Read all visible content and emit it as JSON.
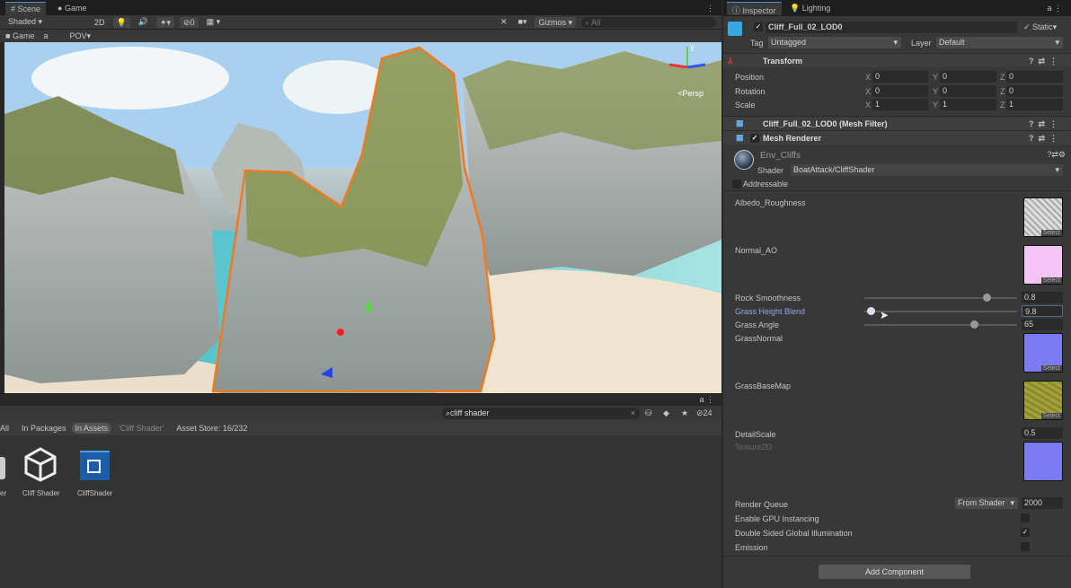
{
  "scene_tabs": [
    {
      "label": "Scene",
      "icon": "hash-icon"
    },
    {
      "label": "Game",
      "icon": "gamepad-icon"
    }
  ],
  "toolbar": {
    "shading": "Shaded",
    "mode_2d": "2D",
    "hidden_count": "0",
    "gizmos": "Gizmos",
    "search_placeholder": "All"
  },
  "gamebar": {
    "game": "Game",
    "pov": "POV"
  },
  "gizmo": {
    "y_label": "y",
    "persp": "<Persp"
  },
  "project": {
    "search_value": "cliff shader",
    "count": "24",
    "filters": [
      "All",
      "In Packages",
      "In Assets",
      "'Cliff Shader'",
      "Asset Store: 16/232"
    ],
    "assets": [
      {
        "label": "er",
        "type": "partial"
      },
      {
        "label": "Cliff Shader",
        "type": "unity-logo"
      },
      {
        "label": "CliffShader",
        "type": "shader-graph"
      }
    ]
  },
  "inspector": {
    "tabs": [
      "Inspector",
      "Lighting"
    ],
    "object_name": "Cliff_Full_02_LOD0",
    "static_label": "Static",
    "tag_label": "Tag",
    "tag_value": "Untagged",
    "layer_label": "Layer",
    "layer_value": "Default",
    "transform": {
      "title": "Transform",
      "rows": [
        {
          "label": "Position",
          "x": "0",
          "y": "0",
          "z": "0"
        },
        {
          "label": "Rotation",
          "x": "0",
          "y": "0",
          "z": "0"
        },
        {
          "label": "Scale",
          "x": "1",
          "y": "1",
          "z": "1"
        }
      ]
    },
    "mesh_filter": "Cliff_Full_02_LOD0 (Mesh Filter)",
    "mesh_renderer": "Mesh Renderer",
    "material": {
      "name": "Env_Cliffs",
      "shader_label": "Shader",
      "shader_value": "BoatAttack/CliffShader",
      "addressable": "Addressable"
    },
    "props": {
      "albedo": "Albedo_Roughness",
      "normal": "Normal_AO",
      "rock_smoothness": {
        "label": "Rock Smoothness",
        "value": "0.8",
        "fraction": 0.8
      },
      "grass_height": {
        "label": "Grass Height Blend",
        "value": "9.8",
        "fraction": 0.04
      },
      "grass_angle": {
        "label": "Grass Angle",
        "value": "65",
        "fraction": 0.72
      },
      "grass_normal": "GrassNormal",
      "grass_base": "GrassBaseMap",
      "detail_scale": {
        "label": "DetailScale",
        "value": "0.5"
      },
      "texture2d": "Texture2D",
      "select": "Select",
      "render_queue": {
        "label": "Render Queue",
        "mode": "From Shader",
        "value": "2000"
      },
      "gpu_instancing": {
        "label": "Enable GPU Instancing",
        "checked": false
      },
      "double_sided": {
        "label": "Double Sided Global Illumination",
        "checked": true,
        "mark": "✓"
      },
      "emission": {
        "label": "Emission",
        "checked": false
      }
    },
    "add_component": "Add Component"
  }
}
